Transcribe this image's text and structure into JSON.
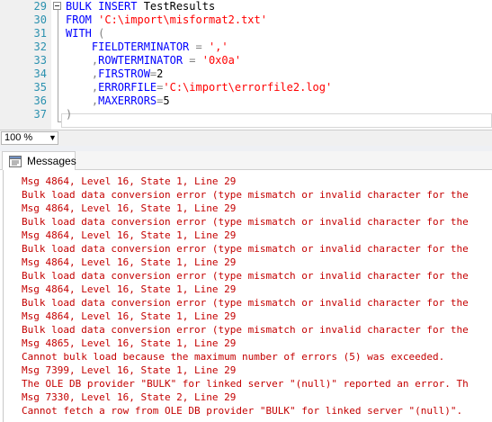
{
  "editor": {
    "lines": [
      {
        "num": "29",
        "segments": [
          {
            "t": "BULK INSERT ",
            "c": "kw"
          },
          {
            "t": "TestResults",
            "c": "pr"
          }
        ]
      },
      {
        "num": "30",
        "segments": [
          {
            "t": "FROM ",
            "c": "kw"
          },
          {
            "t": "'C:\\import\\misformat2.txt'",
            "c": "str"
          }
        ]
      },
      {
        "num": "31",
        "segments": [
          {
            "t": "WITH ",
            "c": "kw"
          },
          {
            "t": "(",
            "c": "gr"
          }
        ]
      },
      {
        "num": "32",
        "segments": [
          {
            "t": "    FIELDTERMINATOR ",
            "c": "kw"
          },
          {
            "t": "= ",
            "c": "gr"
          },
          {
            "t": "','",
            "c": "str"
          }
        ]
      },
      {
        "num": "33",
        "segments": [
          {
            "t": "    ,",
            "c": "gr"
          },
          {
            "t": "ROWTERMINATOR ",
            "c": "kw"
          },
          {
            "t": "= ",
            "c": "gr"
          },
          {
            "t": "'0x0a'",
            "c": "str"
          }
        ]
      },
      {
        "num": "34",
        "segments": [
          {
            "t": "    ,",
            "c": "gr"
          },
          {
            "t": "FIRSTROW",
            "c": "kw"
          },
          {
            "t": "=",
            "c": "gr"
          },
          {
            "t": "2",
            "c": "pr"
          }
        ]
      },
      {
        "num": "35",
        "segments": [
          {
            "t": "    ,",
            "c": "gr"
          },
          {
            "t": "ERRORFILE",
            "c": "kw"
          },
          {
            "t": "=",
            "c": "gr"
          },
          {
            "t": "'C:\\import\\errorfile2.log'",
            "c": "str"
          }
        ]
      },
      {
        "num": "36",
        "segments": [
          {
            "t": "    ,",
            "c": "gr"
          },
          {
            "t": "MAXERRORS",
            "c": "kw"
          },
          {
            "t": "=",
            "c": "gr"
          },
          {
            "t": "5",
            "c": "pr"
          }
        ]
      },
      {
        "num": "37",
        "segments": [
          {
            "t": ")",
            "c": "gr"
          }
        ]
      }
    ]
  },
  "zoom": {
    "value": "100 %",
    "arrow_icon": "chevron-down-icon"
  },
  "results": {
    "tab_label": "Messages",
    "tab_icon": "messages-icon",
    "messages": [
      "Msg 4864, Level 16, State 1, Line 29",
      "Bulk load data conversion error (type mismatch or invalid character for the",
      "Msg 4864, Level 16, State 1, Line 29",
      "Bulk load data conversion error (type mismatch or invalid character for the",
      "Msg 4864, Level 16, State 1, Line 29",
      "Bulk load data conversion error (type mismatch or invalid character for the",
      "Msg 4864, Level 16, State 1, Line 29",
      "Bulk load data conversion error (type mismatch or invalid character for the",
      "Msg 4864, Level 16, State 1, Line 29",
      "Bulk load data conversion error (type mismatch or invalid character for the",
      "Msg 4864, Level 16, State 1, Line 29",
      "Bulk load data conversion error (type mismatch or invalid character for the",
      "Msg 4865, Level 16, State 1, Line 29",
      "Cannot bulk load because the maximum number of errors (5) was exceeded.",
      "Msg 7399, Level 16, State 1, Line 29",
      "The OLE DB provider \"BULK\" for linked server \"(null)\" reported an error. Th",
      "Msg 7330, Level 16, State 2, Line 29",
      "Cannot fetch a row from OLE DB provider \"BULK\" for linked server \"(null)\"."
    ]
  },
  "colors": {
    "keyword": "#0000ff",
    "string": "#ff0000",
    "operator": "#808080",
    "error_text": "#c40000",
    "line_number": "#2b91af"
  }
}
